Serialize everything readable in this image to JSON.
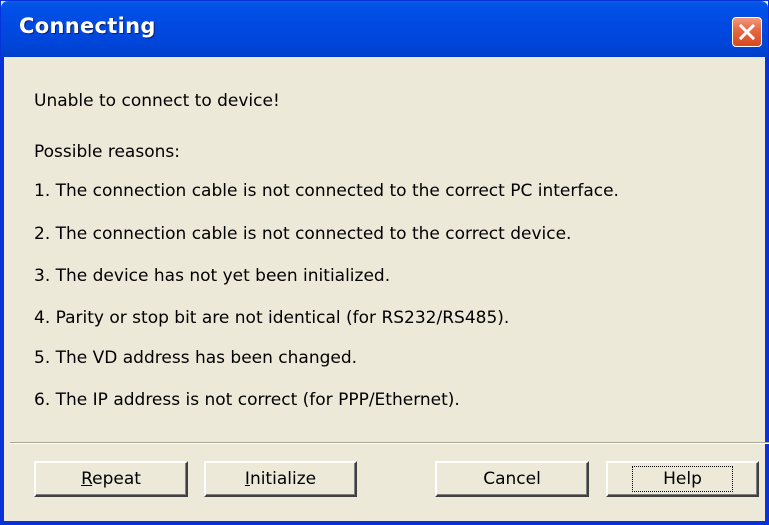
{
  "window": {
    "title": "Connecting"
  },
  "message": {
    "headline": "Unable to connect to device!",
    "reasons_title": "Possible reasons:",
    "reasons": [
      "1. The connection cable is not connected to the correct PC interface.",
      "2. The connection cable is not connected to the correct device.",
      "3. The device has not yet been initialized.",
      "4. Parity or stop bit are not identical (for RS232/RS485).",
      "5. The VD address has been changed.",
      "6. The IP address is not correct (for PPP/Ethernet)."
    ]
  },
  "buttons": {
    "repeat": {
      "mnemonic": "R",
      "rest": "epeat"
    },
    "initialize": {
      "mnemonic": "I",
      "rest": "nitialize"
    },
    "cancel": {
      "label": "Cancel"
    },
    "help": {
      "label": "Help"
    }
  },
  "icons": {
    "close": "close-icon"
  },
  "colors": {
    "titlebar": "#0054e3",
    "close_button": "#e56a44",
    "dialog_background": "#ece9d8"
  }
}
